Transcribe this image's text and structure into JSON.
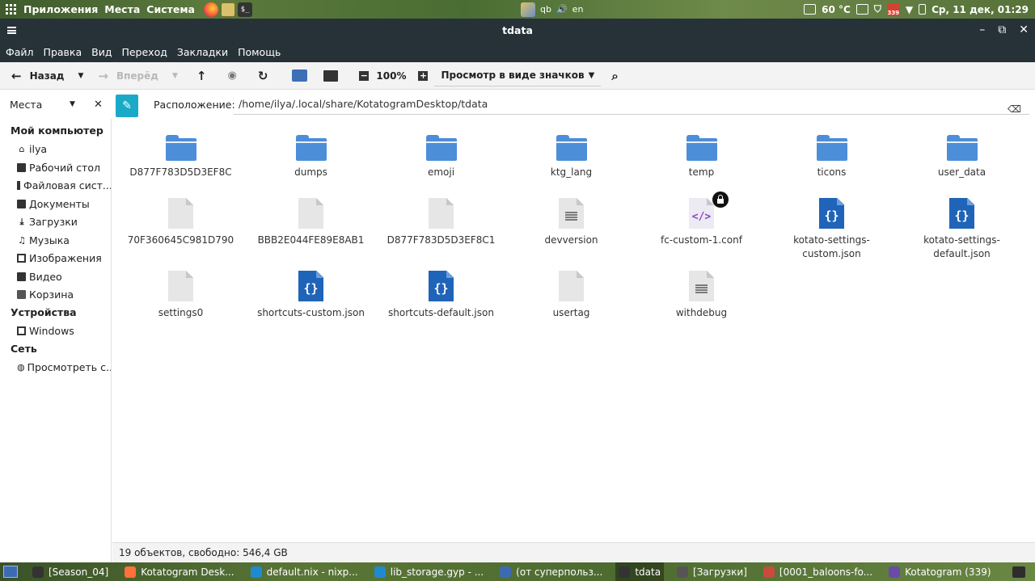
{
  "top_panel": {
    "menus": [
      "Приложения",
      "Места",
      "Система"
    ],
    "temperature": "60 °C",
    "notification_count": "339",
    "clock": "Ср, 11 дек, 01:29",
    "qb": "qb",
    "keyboard_layout": "en"
  },
  "window": {
    "title": "tdata",
    "menu": [
      "Файл",
      "Правка",
      "Вид",
      "Переход",
      "Закладки",
      "Помощь"
    ]
  },
  "toolbar": {
    "back_label": "Назад",
    "forward_label": "Вперёд",
    "zoom": "100%",
    "view_mode": "Просмотр в виде значков"
  },
  "location": {
    "sidebar_title": "Места",
    "label": "Расположение:",
    "path": "/home/ilya/.local/share/KotatogramDesktop/tdata"
  },
  "sidebar": {
    "my_computer": "Мой компьютер",
    "items": [
      "ilya",
      "Рабочий стол",
      "Файловая сист...",
      "Документы",
      "Загрузки",
      "Музыка",
      "Изображения",
      "Видео",
      "Корзина"
    ],
    "devices": "Устройства",
    "windows": "Windows",
    "network": "Сеть",
    "browse_network": "Просмотреть с..."
  },
  "files": [
    {
      "name": "D877F783D5D3EF8C",
      "type": "folder"
    },
    {
      "name": "dumps",
      "type": "folder"
    },
    {
      "name": "emoji",
      "type": "folder"
    },
    {
      "name": "ktg_lang",
      "type": "folder"
    },
    {
      "name": "temp",
      "type": "folder"
    },
    {
      "name": "ticons",
      "type": "folder"
    },
    {
      "name": "user_data",
      "type": "folder"
    },
    {
      "name": "70F360645C981D790",
      "type": "blank"
    },
    {
      "name": "BBB2E044FE89E8AB1",
      "type": "blank"
    },
    {
      "name": "D877F783D5D3EF8C1",
      "type": "blank"
    },
    {
      "name": "devversion",
      "type": "text"
    },
    {
      "name": "fc-custom-1.conf",
      "type": "code"
    },
    {
      "name": "kotato-settings-custom.json",
      "type": "json"
    },
    {
      "name": "kotato-settings-default.json",
      "type": "json"
    },
    {
      "name": "settings0",
      "type": "blank"
    },
    {
      "name": "shortcuts-custom.json",
      "type": "json"
    },
    {
      "name": "shortcuts-default.json",
      "type": "json"
    },
    {
      "name": "usertag",
      "type": "blank"
    },
    {
      "name": "withdebug",
      "type": "text"
    }
  ],
  "status": "19 объектов, свободно: 546,4 GB",
  "taskbar": [
    {
      "label": "[Season_04]",
      "color": "#333333"
    },
    {
      "label": "Kotatogram Desk...",
      "color": "#ff7139"
    },
    {
      "label": "default.nix - nixp...",
      "color": "#1f8ad2"
    },
    {
      "label": "lib_storage.gyp - ...",
      "color": "#1f8ad2"
    },
    {
      "label": "(от суперпольз...",
      "color": "#3d6bb3"
    },
    {
      "label": "tdata",
      "color": "#333333"
    },
    {
      "label": "[Загрузки]",
      "color": "#555555"
    },
    {
      "label": "[0001_baloons-fo...",
      "color": "#c94b3b"
    },
    {
      "label": "Kotatogram (339)",
      "color": "#6b4aa8"
    }
  ]
}
